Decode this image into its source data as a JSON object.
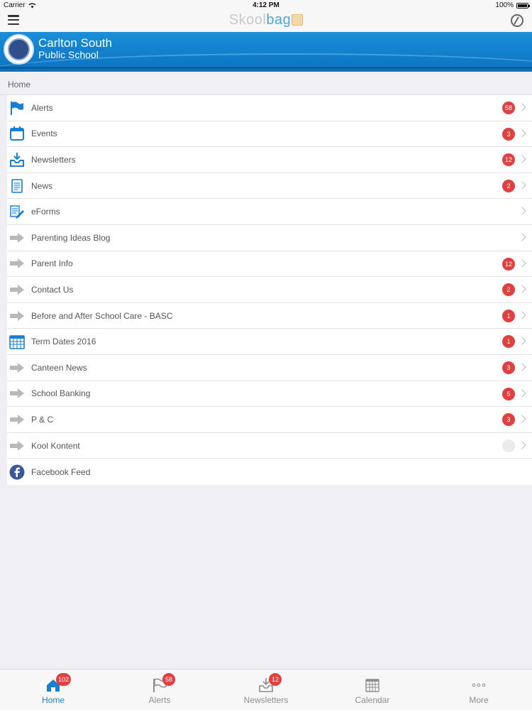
{
  "status_bar": {
    "carrier": "Carrier",
    "time": "4:12 PM",
    "battery": "100%"
  },
  "nav": {
    "brand_part1": "Skool",
    "brand_part2": "bag"
  },
  "school": {
    "name_line1": "Carlton South",
    "name_line2": "Public School"
  },
  "breadcrumb": "Home",
  "colors": {
    "accent": "#1a7fd1",
    "badge": "#e04040",
    "banner": "#0b72c2"
  },
  "menu": [
    {
      "label": "Alerts",
      "icon": "flag-icon",
      "badge": "58"
    },
    {
      "label": "Events",
      "icon": "calendar-icon",
      "badge": "3"
    },
    {
      "label": "Newsletters",
      "icon": "inbox-download-icon",
      "badge": "12"
    },
    {
      "label": "News",
      "icon": "document-icon",
      "badge": "2"
    },
    {
      "label": "eForms",
      "icon": "form-edit-icon",
      "badge": ""
    },
    {
      "label": "Parenting Ideas Blog",
      "icon": "arrow-right-icon",
      "badge": ""
    },
    {
      "label": "Parent Info",
      "icon": "arrow-right-icon",
      "badge": "12"
    },
    {
      "label": "Contact Us",
      "icon": "arrow-right-icon",
      "badge": "2"
    },
    {
      "label": "Before and After School Care - BASC",
      "icon": "arrow-right-icon",
      "badge": "1"
    },
    {
      "label": "Term Dates 2016",
      "icon": "calendar-grid-icon",
      "badge": "1"
    },
    {
      "label": "Canteen News",
      "icon": "arrow-right-icon",
      "badge": "3"
    },
    {
      "label": "School Banking",
      "icon": "arrow-right-icon",
      "badge": "5"
    },
    {
      "label": "P & C",
      "icon": "arrow-right-icon",
      "badge": "3"
    },
    {
      "label": "Kool Kontent",
      "icon": "arrow-right-icon",
      "badge": ""
    },
    {
      "label": "Facebook Feed",
      "icon": "facebook-icon",
      "badge": ""
    }
  ],
  "tabs": [
    {
      "label": "Home",
      "icon": "home-icon",
      "badge": "102",
      "active": true
    },
    {
      "label": "Alerts",
      "icon": "flag-icon",
      "badge": "58",
      "active": false
    },
    {
      "label": "Newsletters",
      "icon": "inbox-download-icon",
      "badge": "12",
      "active": false
    },
    {
      "label": "Calendar",
      "icon": "calendar-grid-icon",
      "badge": "",
      "active": false
    },
    {
      "label": "More",
      "icon": "more-icon",
      "badge": "",
      "active": false
    }
  ]
}
